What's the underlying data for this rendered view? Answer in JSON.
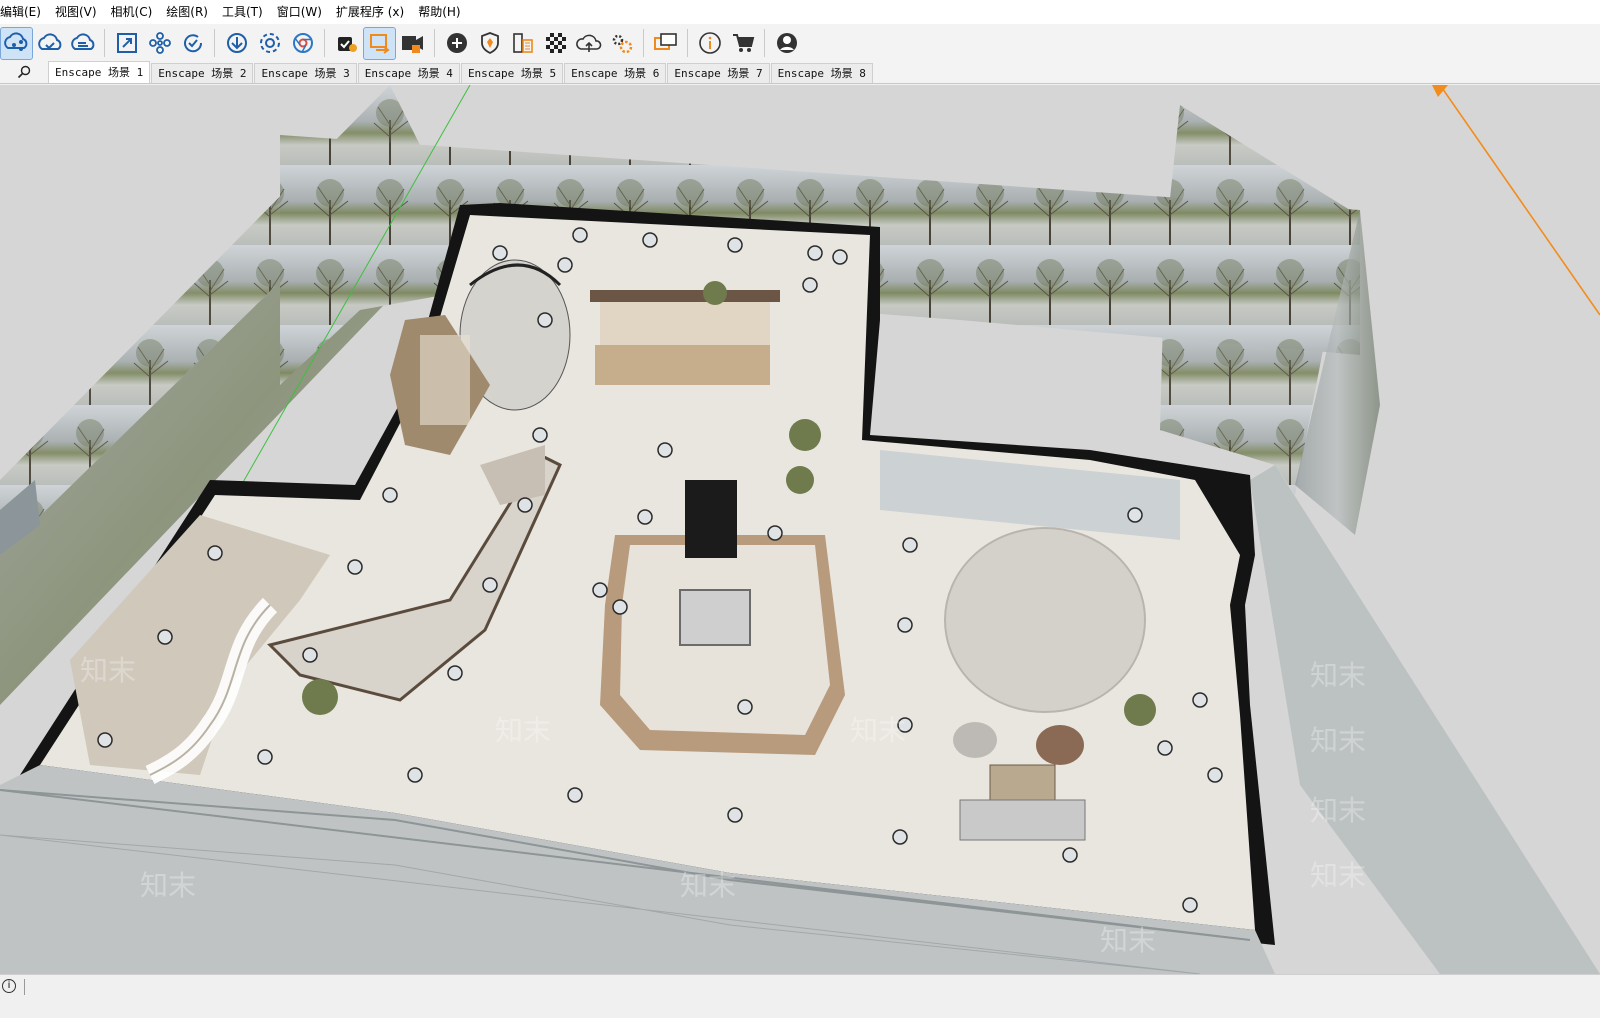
{
  "menu": {
    "items": [
      "编辑(E)",
      "视图(V)",
      "相机(C)",
      "绘图(R)",
      "工具(T)",
      "窗口(W)",
      "扩展程序 (x)",
      "帮助(H)"
    ]
  },
  "toolbar": {
    "buttons": [
      {
        "icon": "share-model-icon",
        "active": true
      },
      {
        "icon": "cloud-sync-icon"
      },
      {
        "icon": "cloud-upload-icon"
      },
      {
        "icon": "resize-frame-icon"
      },
      {
        "icon": "network-nodes-icon"
      },
      {
        "icon": "refresh-check-icon"
      },
      {
        "icon": "download-arrow-icon"
      },
      {
        "icon": "gear-settings-icon"
      },
      {
        "icon": "chrome-browser-icon"
      },
      {
        "icon": "enscape-start-icon"
      },
      {
        "icon": "enscape-sync-icon",
        "active": true
      },
      {
        "icon": "video-camera-icon"
      },
      {
        "icon": "add-circle-icon"
      },
      {
        "icon": "enscape-shield-icon"
      },
      {
        "icon": "material-library-icon"
      },
      {
        "icon": "checker-pattern-icon"
      },
      {
        "icon": "cloud-upload-outline-icon"
      },
      {
        "icon": "gears-icon"
      },
      {
        "icon": "chat-windows-icon"
      },
      {
        "icon": "info-icon"
      },
      {
        "icon": "shopping-cart-icon"
      },
      {
        "icon": "user-account-icon"
      }
    ]
  },
  "tabs": {
    "search_icon": "search-icon",
    "items": [
      {
        "label": "Enscape 场景 1",
        "active": true
      },
      {
        "label": "Enscape 场景 2"
      },
      {
        "label": "Enscape 场景 3"
      },
      {
        "label": "Enscape 场景 4"
      },
      {
        "label": "Enscape 场景 5"
      },
      {
        "label": "Enscape 场景 6"
      },
      {
        "label": "Enscape 场景 7"
      },
      {
        "label": "Enscape 场景 8"
      }
    ]
  },
  "viewport": {
    "watermark": "知末"
  },
  "status": {
    "icon": "info-icon"
  },
  "colors": {
    "toolbar_blue": "#1f5fa8",
    "axis_orange": "#f28c1c",
    "axis_green": "#3fbf3f",
    "wall_black": "#141414",
    "floor": "#e9e6df"
  }
}
